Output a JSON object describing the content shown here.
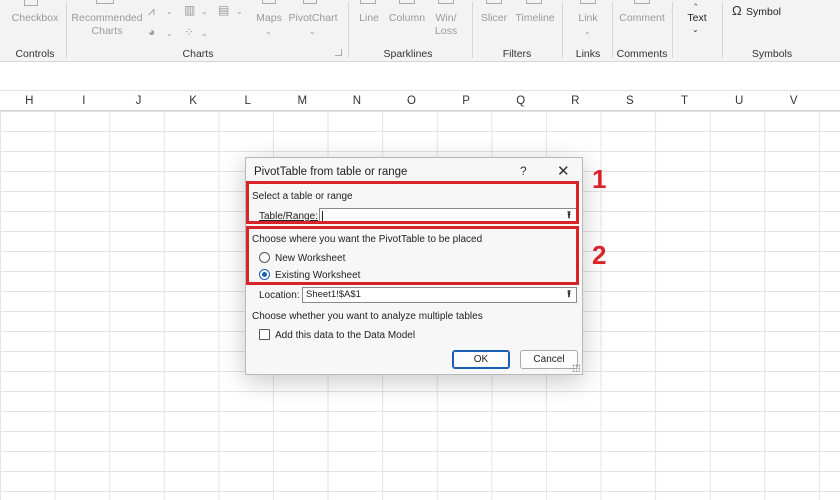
{
  "ribbon": {
    "controls": {
      "checkbox_label": "Checkbox",
      "group_label": "Controls"
    },
    "charts": {
      "recommended_label": "Recommended\nCharts",
      "maps_label": "Maps",
      "pivotchart_label": "PivotChart",
      "group_label": "Charts"
    },
    "sparklines": {
      "line_label": "Line",
      "column_label": "Column",
      "winloss_label": "Win/\nLoss",
      "group_label": "Sparklines"
    },
    "filters": {
      "slicer_label": "Slicer",
      "timeline_label": "Timeline",
      "group_label": "Filters"
    },
    "links": {
      "link_label": "Link",
      "group_label": "Links"
    },
    "comments": {
      "comment_label": "Comment",
      "group_label": "Comments"
    },
    "text": {
      "text_label": "Text"
    },
    "symbols": {
      "symbol_label": "Symbol",
      "group_label": "Symbols"
    }
  },
  "columns": [
    "H",
    "I",
    "J",
    "K",
    "L",
    "M",
    "N",
    "O",
    "P",
    "Q",
    "R",
    "S",
    "T",
    "U",
    "V"
  ],
  "dialog": {
    "title": "PivotTable from table or range",
    "help_label": "?",
    "close_label": "✕",
    "section1_label": "Select a table or range",
    "table_range_label": "Table/Range:",
    "table_range_value": "",
    "section2_label": "Choose where you want the PivotTable to be placed",
    "new_worksheet_label": "New Worksheet",
    "existing_worksheet_label": "Existing Worksheet",
    "selected_option": "existing_worksheet",
    "location_label": "Location:",
    "location_value": "Sheet1!$A$1",
    "section3_label": "Choose whether you want to analyze multiple tables",
    "data_model_label": "Add this data to the Data Model",
    "data_model_checked": false,
    "ok_label": "OK",
    "cancel_label": "Cancel"
  },
  "annotations": {
    "label1": "1",
    "label2": "2"
  },
  "colors": {
    "annotation_red": "#d9232b",
    "accent_blue": "#1a5fb4"
  }
}
